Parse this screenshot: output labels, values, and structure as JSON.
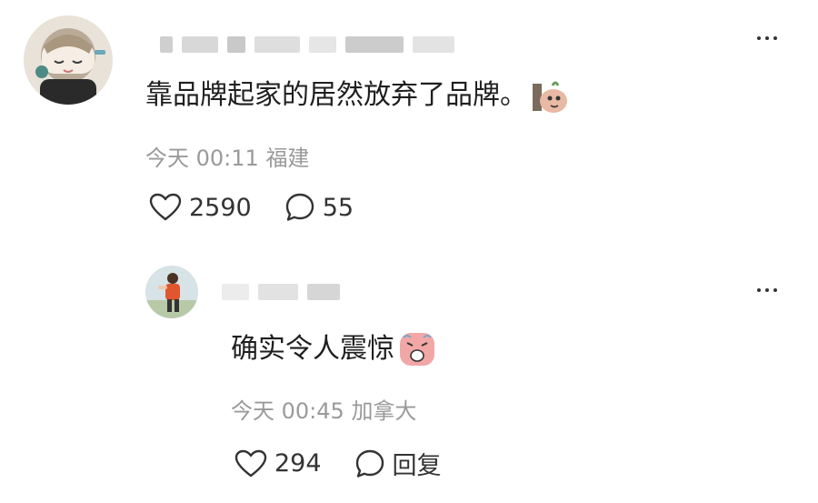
{
  "comments": [
    {
      "text": "靠品牌起家的居然放弃了品牌。",
      "time": "今天 00:11",
      "location": "福建",
      "likes": "2590",
      "replies": "55",
      "emoji": "peeking-emoji-icon"
    },
    {
      "text": "确实令人震惊",
      "time": "今天 00:45",
      "location": "加拿大",
      "likes": "294",
      "reply_label": "回复",
      "emoji": "shocked-face-emoji-icon"
    }
  ],
  "colors": {
    "text": "#1f1f1f",
    "meta": "#9a9a9a",
    "icon": "#333333",
    "background": "#ffffff"
  }
}
